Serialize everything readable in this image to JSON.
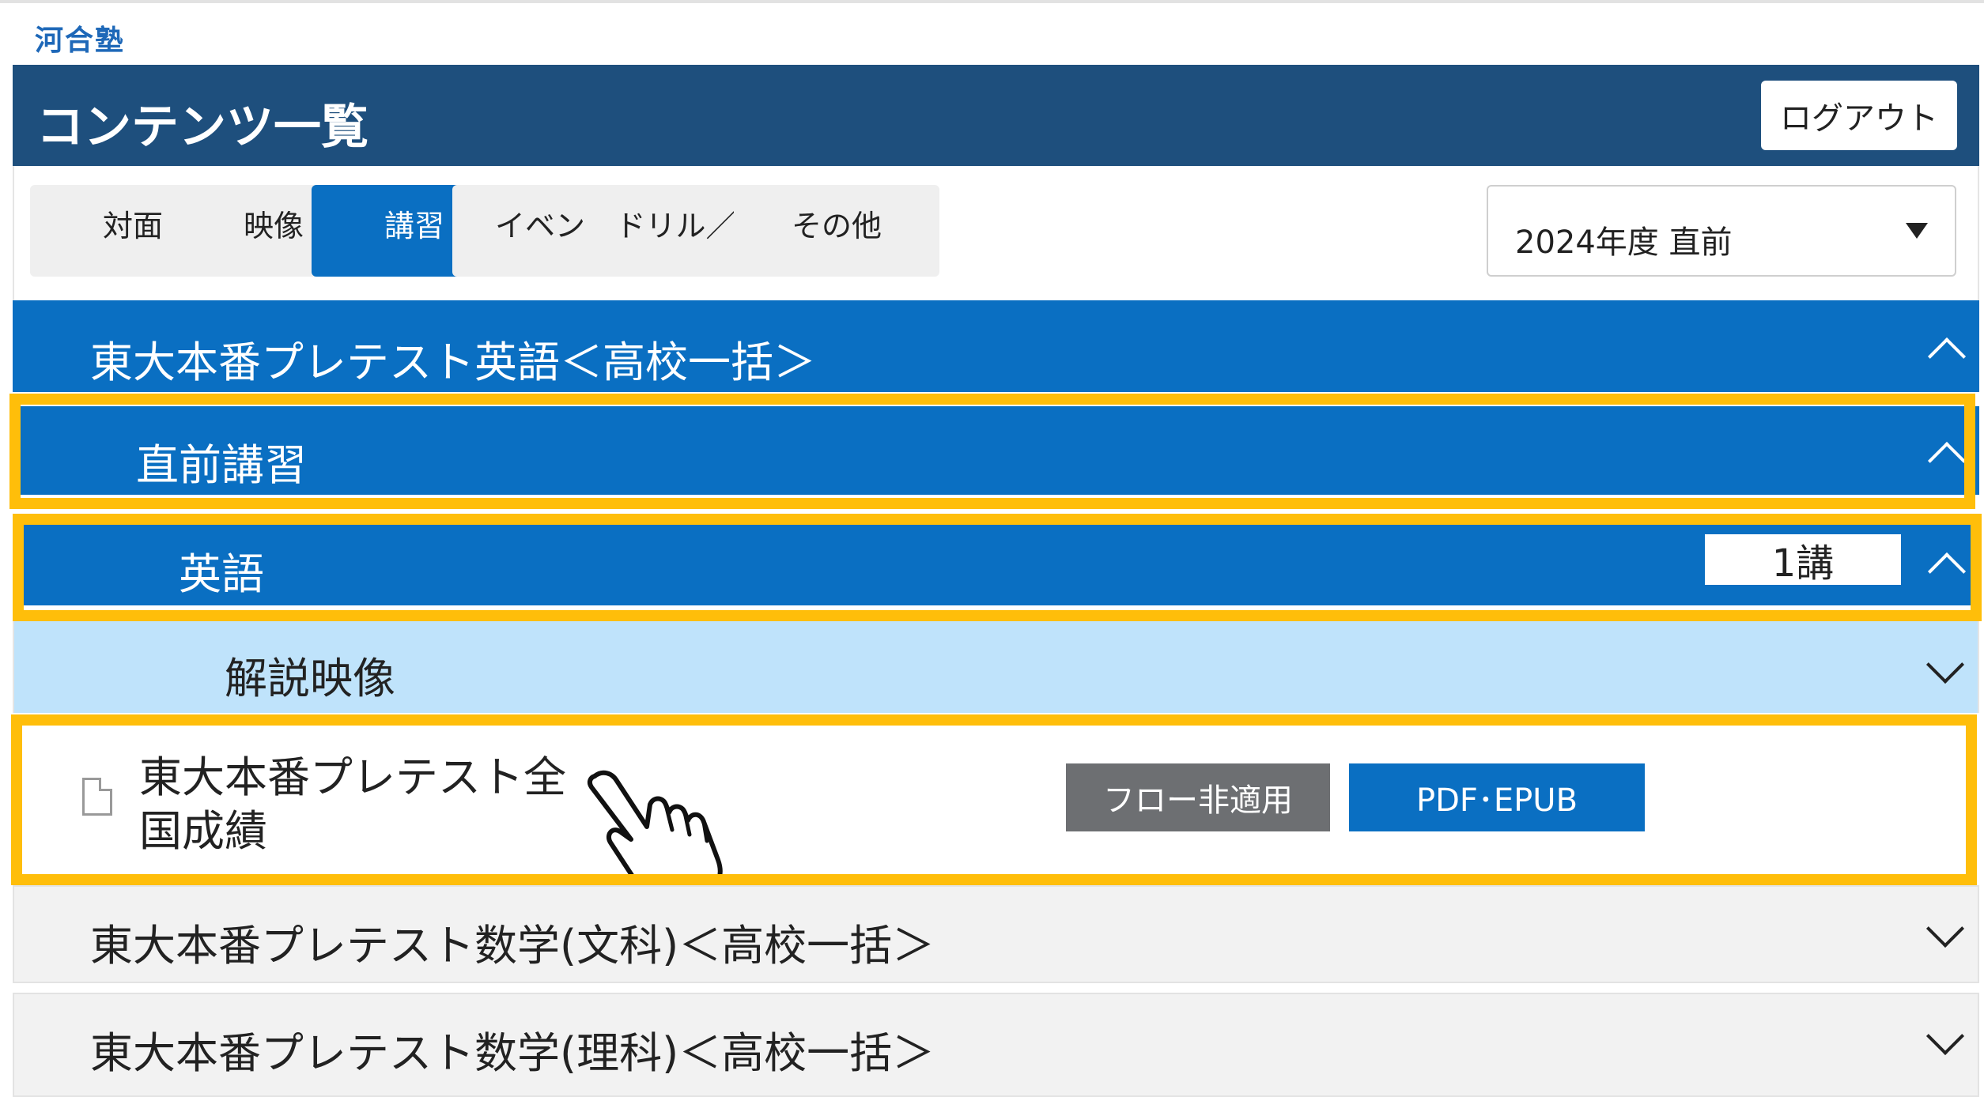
{
  "logo_text": "河合塾",
  "header": {
    "title": "コンテンツ一覧",
    "logout_label": "ログアウト"
  },
  "tabs": [
    {
      "label": "対面",
      "active": false
    },
    {
      "label": "映像",
      "active": false
    },
    {
      "label": "講習",
      "active": true
    },
    {
      "label": "イベント",
      "active": false
    },
    {
      "label": "ドリル／OL",
      "active": false
    },
    {
      "label": "その他",
      "active": false
    }
  ],
  "year_select": {
    "value": "2024年度 直前"
  },
  "sections": {
    "main": {
      "title": "東大本番プレテスト英語＜高校一括＞",
      "expanded": true
    },
    "sub": {
      "title": "直前講習",
      "expanded": true
    },
    "subject": {
      "title": "英語",
      "count": "1講",
      "expanded": true
    },
    "video": {
      "title": "解説映像",
      "expanded": false
    },
    "item": {
      "title": "東大本番プレテスト全国成績",
      "flow_button": "フロー非適用",
      "pdf_button": "PDF･EPUB"
    },
    "others": [
      {
        "title": "東大本番プレテスト数学(文科)＜高校一括＞"
      },
      {
        "title": "東大本番プレテスト数学(理科)＜高校一括＞"
      }
    ]
  },
  "colors": {
    "header_bg": "#1e4f7d",
    "primary_blue": "#0a6fc2",
    "light_blue": "#bfe3fb",
    "highlight": "#ffbe0a",
    "gray_button": "#6d6f72"
  }
}
